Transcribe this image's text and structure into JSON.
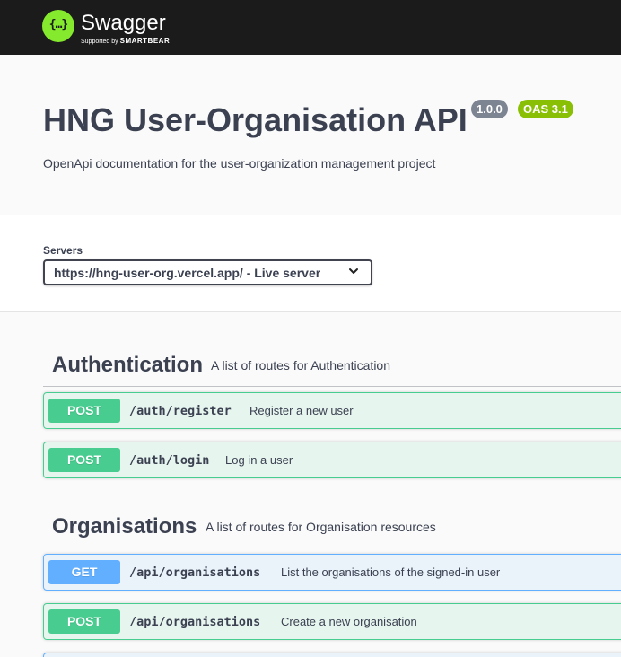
{
  "topbar": {
    "logo_glyph": "{…}",
    "brand": "Swagger",
    "brand_sub_prefix": "Supported by",
    "brand_sub_company": "SMARTBEAR"
  },
  "info": {
    "title": "HNG User-Organisation API",
    "version": "1.0.0",
    "oas": "OAS 3.1",
    "description": "OpenApi documentation for the user-organization management project"
  },
  "servers": {
    "label": "Servers",
    "selected": "https://hng-user-org.vercel.app/ - Live server"
  },
  "tags": [
    {
      "name": "Authentication",
      "description": "A list of routes for Authentication",
      "operations": [
        {
          "method": "POST",
          "path": "/auth/register",
          "summary": "Register a new user"
        },
        {
          "method": "POST",
          "path": "/auth/login",
          "summary": "Log in a user"
        }
      ]
    },
    {
      "name": "Organisations",
      "description": "A list of routes for Organisation resources",
      "operations": [
        {
          "method": "GET",
          "path": "/api/organisations",
          "summary": "List the organisations of the signed-in user"
        },
        {
          "method": "POST",
          "path": "/api/organisations",
          "summary": "Create a new organisation"
        }
      ]
    }
  ],
  "colors": {
    "topbar": "#1b1b1b",
    "logo": "#85ea2d",
    "post": "#49cc90",
    "get": "#61affe",
    "version_badge": "#7d8492",
    "oas_badge": "#89bf04"
  }
}
